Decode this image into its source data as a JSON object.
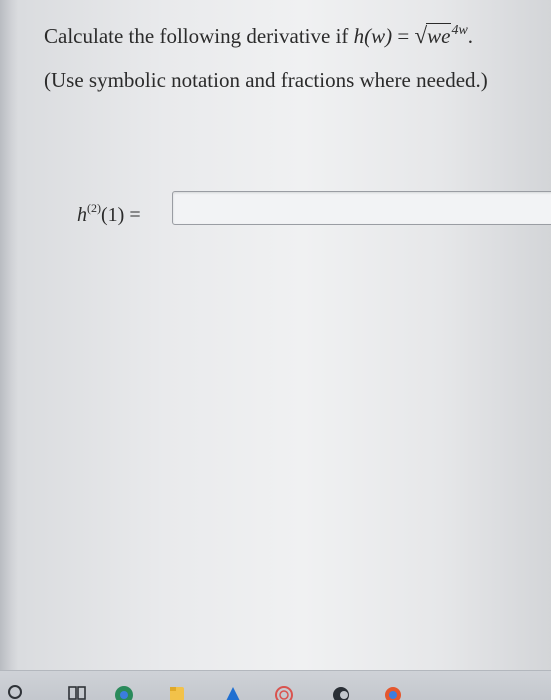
{
  "question": {
    "prefix": "Calculate the following derivative if ",
    "func": "h(w)",
    "equals": " = ",
    "radicand": "we",
    "exponent": "4w",
    "suffix": "."
  },
  "hint": "(Use symbolic notation and fractions where needed.)",
  "answer": {
    "label_base": "h",
    "label_order": "(2)",
    "label_arg": "(1) =",
    "value": ""
  },
  "taskbar": {
    "icons": [
      "search-circle-icon",
      "task-view-icon",
      "chrome-icon",
      "file-explorer-icon",
      "mail-icon",
      "app-icon",
      "edge-icon"
    ]
  }
}
